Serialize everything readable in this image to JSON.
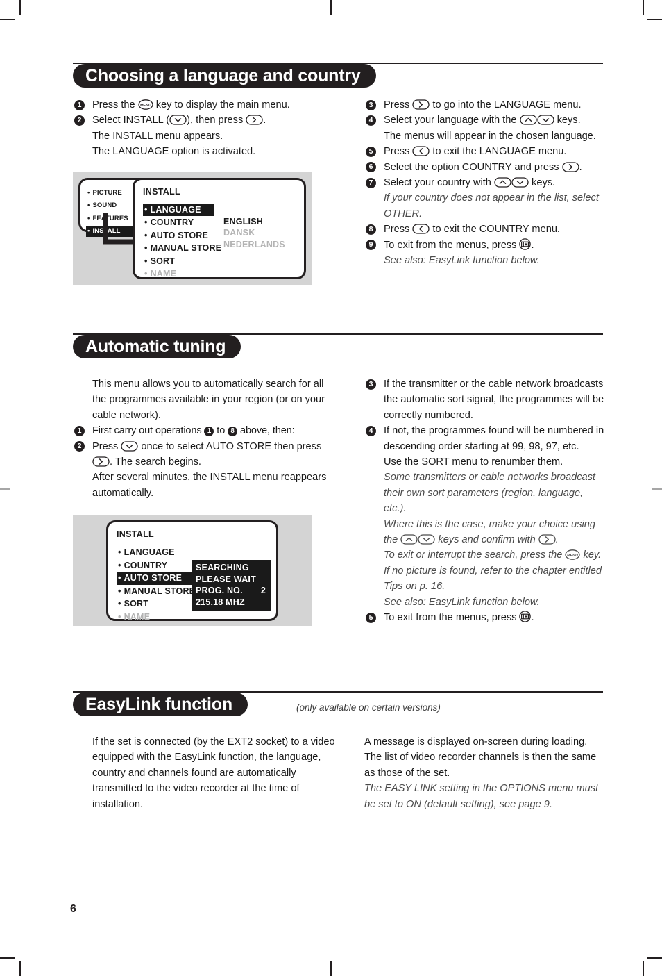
{
  "page": {
    "number": "6"
  },
  "sections": [
    {
      "id": "choosing-language-country",
      "title": "Choosing a language and country",
      "note": "",
      "left_steps": [
        {
          "num": "1",
          "parts": [
            {
              "t": "text",
              "v": "Press the "
            },
            {
              "t": "key",
              "v": "menu-key"
            },
            {
              "t": "text",
              "v": " key to display the main menu."
            }
          ]
        },
        {
          "num": "2",
          "parts": [
            {
              "t": "text",
              "v": "Select INSTALL ("
            },
            {
              "t": "key",
              "v": "down-key"
            },
            {
              "t": "text",
              "v": "), then press "
            },
            {
              "t": "key",
              "v": "right-key"
            },
            {
              "t": "text",
              "v": "."
            }
          ]
        }
      ],
      "left_cont": [
        "The INSTALL menu appears.",
        "The LANGUAGE option is activated."
      ],
      "right_steps": [
        {
          "num": "3",
          "parts": [
            {
              "t": "text",
              "v": "Press "
            },
            {
              "t": "key",
              "v": "right-key"
            },
            {
              "t": "text",
              "v": " to go into the LANGUAGE menu."
            }
          ]
        },
        {
          "num": "4",
          "parts": [
            {
              "t": "text",
              "v": "Select your language with the "
            },
            {
              "t": "key",
              "v": "up-key"
            },
            {
              "t": "key",
              "v": "down-key"
            },
            {
              "t": "text",
              "v": " keys."
            }
          ]
        },
        {
          "num": "5",
          "parts": [
            {
              "t": "text",
              "v": "Press "
            },
            {
              "t": "key",
              "v": "left-key"
            },
            {
              "t": "text",
              "v": " to exit the LANGUAGE menu."
            }
          ]
        },
        {
          "num": "6",
          "parts": [
            {
              "t": "text",
              "v": "Select the option COUNTRY and press "
            },
            {
              "t": "key",
              "v": "right-key"
            },
            {
              "t": "text",
              "v": "."
            }
          ]
        },
        {
          "num": "7",
          "parts": [
            {
              "t": "text",
              "v": "Select your country with "
            },
            {
              "t": "key",
              "v": "up-key"
            },
            {
              "t": "key",
              "v": "down-key"
            },
            {
              "t": "text",
              "v": " keys."
            }
          ]
        },
        {
          "num": "8",
          "parts": [
            {
              "t": "text",
              "v": "Press "
            },
            {
              "t": "key",
              "v": "left-key"
            },
            {
              "t": "text",
              "v": " to exit the COUNTRY menu."
            }
          ]
        },
        {
          "num": "9",
          "parts": [
            {
              "t": "text",
              "v": "To exit from the menus, press "
            },
            {
              "t": "key",
              "v": "exit-screen-key"
            },
            {
              "t": "text",
              "v": "."
            }
          ]
        }
      ],
      "right_after_4": "The menus will appear in the chosen language.",
      "right_after_7_italic": "If your country does not appear in the list, select OTHER.",
      "right_after_9_italic": "See also: EasyLink function below."
    },
    {
      "id": "automatic-tuning",
      "title": "Automatic tuning",
      "note": "",
      "left_intro": "This menu allows you to automatically search for all the programmes available in your region (or on your cable network).",
      "left_steps": [
        {
          "num": "1",
          "parts": [
            {
              "t": "text",
              "v": "First carry out operations "
            },
            {
              "t": "inum",
              "v": "1"
            },
            {
              "t": "text",
              "v": " to "
            },
            {
              "t": "inum",
              "v": "8"
            },
            {
              "t": "text",
              "v": " above, then:"
            }
          ]
        },
        {
          "num": "2",
          "parts": [
            {
              "t": "text",
              "v": "Press "
            },
            {
              "t": "key",
              "v": "down-key"
            },
            {
              "t": "text",
              "v": " once to select AUTO STORE then press "
            },
            {
              "t": "key",
              "v": "right-key"
            },
            {
              "t": "text",
              "v": ". The search begins."
            }
          ]
        }
      ],
      "left_cont": [
        "After several minutes, the INSTALL menu reappears automatically."
      ],
      "right_steps": [
        {
          "num": "3",
          "parts": [
            {
              "t": "text",
              "v": "If the transmitter or the cable network broadcasts the automatic sort signal, the programmes will be correctly numbered."
            }
          ]
        },
        {
          "num": "4",
          "parts": [
            {
              "t": "text",
              "v": "If not, the programmes found will be numbered in descending order starting at 99, 98, 97, etc."
            }
          ]
        },
        {
          "num": "5",
          "parts": [
            {
              "t": "text",
              "v": "To exit from the menus, press "
            },
            {
              "t": "key",
              "v": "exit-screen-key"
            },
            {
              "t": "text",
              "v": "."
            }
          ]
        }
      ],
      "right_after_4": "Use the SORT menu to renumber them.",
      "right_italic_1": "Some transmitters or cable networks broadcast their own sort parameters (region, language, etc.).",
      "right_italic_2_a": "Where this is the case, make your choice using the ",
      "right_italic_2_b": " keys and confirm with ",
      "right_italic_2_c": ".",
      "right_italic_3_a": "To exit or interrupt the search, press the ",
      "right_italic_3_b": " key. If no picture is found, refer to the chapter entitled Tips on p. 16.",
      "right_italic_4": "See also: EasyLink function below."
    },
    {
      "id": "easylink-function",
      "title": "EasyLink function",
      "note": "(only available on certain versions)",
      "left_body": "If the set is connected (by the EXT2 socket) to a video equipped with the EasyLink function, the language, country and channels found are automatically transmitted to the video recorder at the time of installation.",
      "right_body": "A message is displayed on-screen during loading. The list of video recorder channels is then the same as those of the set.",
      "right_italic": "The EASY LINK setting in the OPTIONS menu must be set to ON (default setting), see page 9."
    }
  ],
  "diagram_language": {
    "main_menu_items": [
      "PICTURE",
      "SOUND",
      "FEATURES",
      "INSTALL"
    ],
    "main_menu_selected": "INSTALL",
    "install_title": "INSTALL",
    "install_items": [
      "LANGUAGE",
      "COUNTRY",
      "AUTO STORE",
      "MANUAL STORE",
      "SORT",
      "NAME"
    ],
    "install_selected": "LANGUAGE",
    "install_disabled": "NAME",
    "values": [
      "ENGLISH",
      "DANSK",
      "NEDERLANDS"
    ],
    "values_active": "ENGLISH"
  },
  "diagram_autostore": {
    "install_title": "INSTALL",
    "install_items": [
      "LANGUAGE",
      "COUNTRY",
      "AUTO STORE",
      "MANUAL STORE",
      "SORT",
      "NAME"
    ],
    "install_selected": "AUTO STORE",
    "install_disabled": "NAME",
    "search_lines": [
      "SEARCHING",
      "PLEASE WAIT"
    ],
    "prog_label": "PROG. NO.",
    "prog_value": "2",
    "frequency": "215.18 MHZ"
  },
  "colors": {
    "ink": "#231f20",
    "diagram_bg": "#d4d4d4",
    "menu_dim": "#b3b3b3",
    "italic_gray": "#4a4a4a"
  }
}
